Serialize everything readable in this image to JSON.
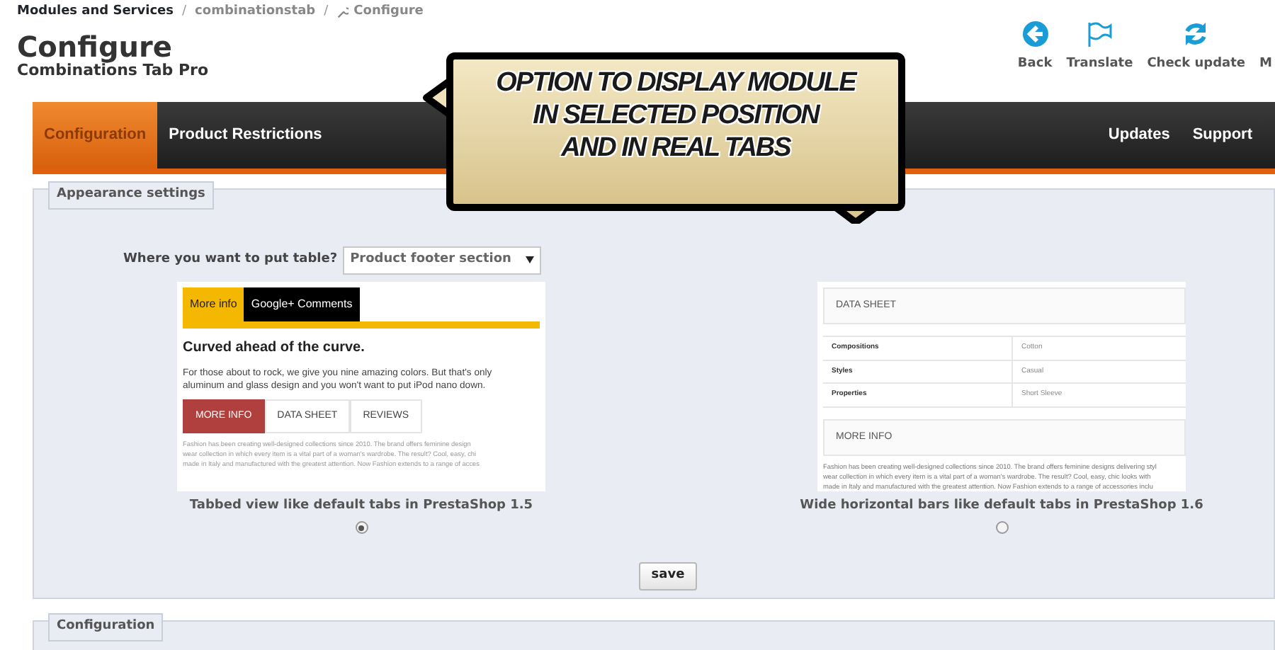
{
  "breadcrumb": [
    {
      "label": "Modules and Services",
      "kind": "link"
    },
    {
      "label": "/",
      "kind": "separator"
    },
    {
      "label": "combinationstab",
      "kind": "link"
    },
    {
      "label": "/",
      "kind": "separator"
    },
    {
      "label": "Configure",
      "kind": "current"
    }
  ],
  "header": {
    "title": "Configure",
    "subtitle": "Combinations Tab Pro"
  },
  "toolbar": [
    {
      "label": "Back",
      "kind": "back"
    },
    {
      "label": "Translate",
      "kind": "flag"
    },
    {
      "label": "Check update",
      "kind": "refresh"
    },
    {
      "label": "M",
      "kind": "none"
    }
  ],
  "nav": {
    "left": [
      {
        "label": "Configuration",
        "selected": true
      },
      {
        "label": "Product Restrictions",
        "selected": false
      }
    ],
    "right": [
      {
        "label": "Updates",
        "selected": false
      },
      {
        "label": "Support",
        "selected": false
      }
    ]
  },
  "callout": {
    "lines": [
      "OPTION TO DISPLAY MODULE",
      "IN SELECTED POSITION",
      "AND IN REAL TABS"
    ]
  },
  "appearance": {
    "legend": "Appearance settings",
    "question": "Where you want to put table?",
    "select_value": "Product footer section",
    "options": [
      {
        "kind": "tabbed",
        "caption": "Tabbed view like default tabs in PrestaShop 1.5",
        "selected": true,
        "top_tabs": [
          {
            "label": "More info",
            "selected": true
          },
          {
            "label": "Google+ Comments",
            "selected": false
          }
        ],
        "heading": "Curved ahead of the curve.",
        "body": [
          "For those about to rock, we give you nine amazing colors. But that's only",
          "aluminum and glass design and you won't want to put iPod nano down."
        ],
        "tabs": [
          {
            "label": "MORE INFO",
            "selected": true
          },
          {
            "label": "DATA SHEET",
            "selected": false
          },
          {
            "label": "REVIEWS",
            "selected": false
          }
        ],
        "paragraph": [
          "Fashion has been creating well-designed collections since 2010. The brand offers feminine design",
          "wear collection in which every item is a vital part of a woman's wardrobe. The result? Cool, easy, chi",
          "made in Italy and manufactured with the greatest attention. Now Fashion extends to a range of acces"
        ]
      },
      {
        "kind": "bars",
        "caption": "Wide horizontal bars like default tabs in PrestaShop 1.6",
        "selected": false,
        "sheet_title": "DATA SHEET",
        "rows": [
          {
            "name": "Compositions",
            "value": "Cotton"
          },
          {
            "name": "Styles",
            "value": "Casual"
          },
          {
            "name": "Properties",
            "value": "Short Sleeve"
          }
        ],
        "info_title": "MORE INFO",
        "paragraph": [
          "Fashion has been creating well-designed collections since 2010. The brand offers feminine designs delivering styl",
          "wear collection in which every item is a vital part of a woman's wardrobe. The result? Cool, easy, chic looks with",
          "made in Italy and manufactured with the greatest attention. Now Fashion extends to a range of accessories inclu"
        ]
      }
    ],
    "save": "save"
  },
  "configuration": {
    "legend": "Configuration"
  }
}
